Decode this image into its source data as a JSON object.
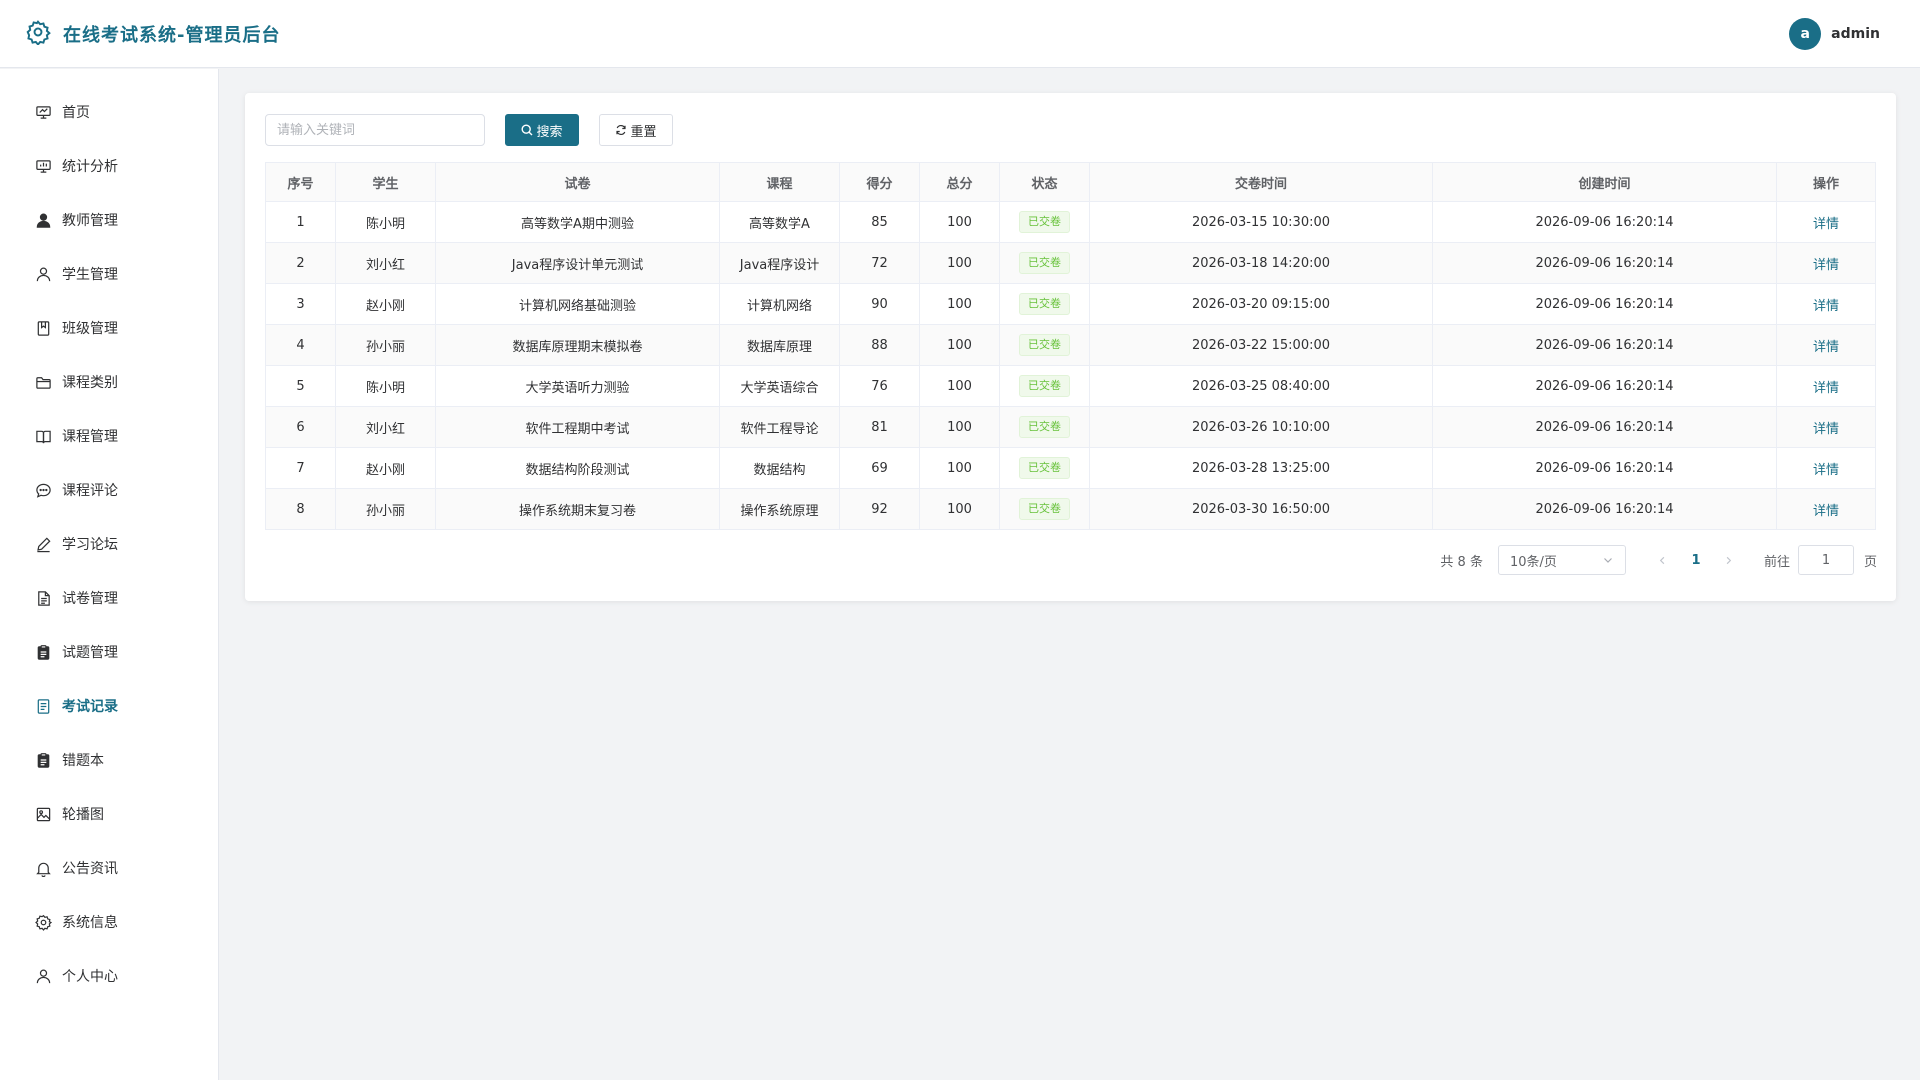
{
  "header": {
    "title": "在线考试系统-管理员后台",
    "avatar_letter": "a",
    "username": "admin"
  },
  "sidebar": {
    "items": [
      {
        "label": "首页",
        "icon": "monitor-icon"
      },
      {
        "label": "统计分析",
        "icon": "chart-monitor-icon"
      },
      {
        "label": "教师管理",
        "icon": "user-filled-icon"
      },
      {
        "label": "学生管理",
        "icon": "user-outline-icon"
      },
      {
        "label": "班级管理",
        "icon": "collection-icon"
      },
      {
        "label": "课程类别",
        "icon": "folder-icon"
      },
      {
        "label": "课程管理",
        "icon": "book-icon"
      },
      {
        "label": "课程评论",
        "icon": "chat-icon"
      },
      {
        "label": "学习论坛",
        "icon": "edit-pen-icon"
      },
      {
        "label": "试卷管理",
        "icon": "document-icon"
      },
      {
        "label": "试题管理",
        "icon": "clipboard-icon"
      },
      {
        "label": "考试记录",
        "icon": "tickets-icon",
        "active": true
      },
      {
        "label": "错题本",
        "icon": "clipboard-icon"
      },
      {
        "label": "轮播图",
        "icon": "picture-icon"
      },
      {
        "label": "公告资讯",
        "icon": "bell-icon"
      },
      {
        "label": "系统信息",
        "icon": "setting-icon"
      },
      {
        "label": "个人中心",
        "icon": "user-outline-icon"
      }
    ]
  },
  "search": {
    "placeholder": "请输入关键词",
    "value": "",
    "search_label": "搜索",
    "reset_label": "重置"
  },
  "table": {
    "columns": [
      "序号",
      "学生",
      "试卷",
      "课程",
      "得分",
      "总分",
      "状态",
      "交卷时间",
      "创建时间",
      "操作"
    ],
    "rows": [
      {
        "index": "1",
        "student": "陈小明",
        "paper": "高等数学A期中测验",
        "course": "高等数学A",
        "score": "85",
        "total": "100",
        "status": "已交卷",
        "submitted": "2026-03-15 10:30:00",
        "created": "2026-09-06 16:20:14",
        "action": "详情"
      },
      {
        "index": "2",
        "student": "刘小红",
        "paper": "Java程序设计单元测试",
        "course": "Java程序设计",
        "score": "72",
        "total": "100",
        "status": "已交卷",
        "submitted": "2026-03-18 14:20:00",
        "created": "2026-09-06 16:20:14",
        "action": "详情"
      },
      {
        "index": "3",
        "student": "赵小刚",
        "paper": "计算机网络基础测验",
        "course": "计算机网络",
        "score": "90",
        "total": "100",
        "status": "已交卷",
        "submitted": "2026-03-20 09:15:00",
        "created": "2026-09-06 16:20:14",
        "action": "详情"
      },
      {
        "index": "4",
        "student": "孙小丽",
        "paper": "数据库原理期末模拟卷",
        "course": "数据库原理",
        "score": "88",
        "total": "100",
        "status": "已交卷",
        "submitted": "2026-03-22 15:00:00",
        "created": "2026-09-06 16:20:14",
        "action": "详情"
      },
      {
        "index": "5",
        "student": "陈小明",
        "paper": "大学英语听力测验",
        "course": "大学英语综合",
        "score": "76",
        "total": "100",
        "status": "已交卷",
        "submitted": "2026-03-25 08:40:00",
        "created": "2026-09-06 16:20:14",
        "action": "详情"
      },
      {
        "index": "6",
        "student": "刘小红",
        "paper": "软件工程期中考试",
        "course": "软件工程导论",
        "score": "81",
        "total": "100",
        "status": "已交卷",
        "submitted": "2026-03-26 10:10:00",
        "created": "2026-09-06 16:20:14",
        "action": "详情"
      },
      {
        "index": "7",
        "student": "赵小刚",
        "paper": "数据结构阶段测试",
        "course": "数据结构",
        "score": "69",
        "total": "100",
        "status": "已交卷",
        "submitted": "2026-03-28 13:25:00",
        "created": "2026-09-06 16:20:14",
        "action": "详情"
      },
      {
        "index": "8",
        "student": "孙小丽",
        "paper": "操作系统期末复习卷",
        "course": "操作系统原理",
        "score": "92",
        "total": "100",
        "status": "已交卷",
        "submitted": "2026-03-30 16:50:00",
        "created": "2026-09-06 16:20:14",
        "action": "详情"
      }
    ]
  },
  "pagination": {
    "total_text": "共 8 条",
    "page_size": "10条/页",
    "current_page": "1",
    "goto_label": "前往",
    "goto_value": "1",
    "page_suffix": "页"
  },
  "colors": {
    "primary": "#1a6e87",
    "success": "#67c23a",
    "background": "#f2f3f5"
  }
}
